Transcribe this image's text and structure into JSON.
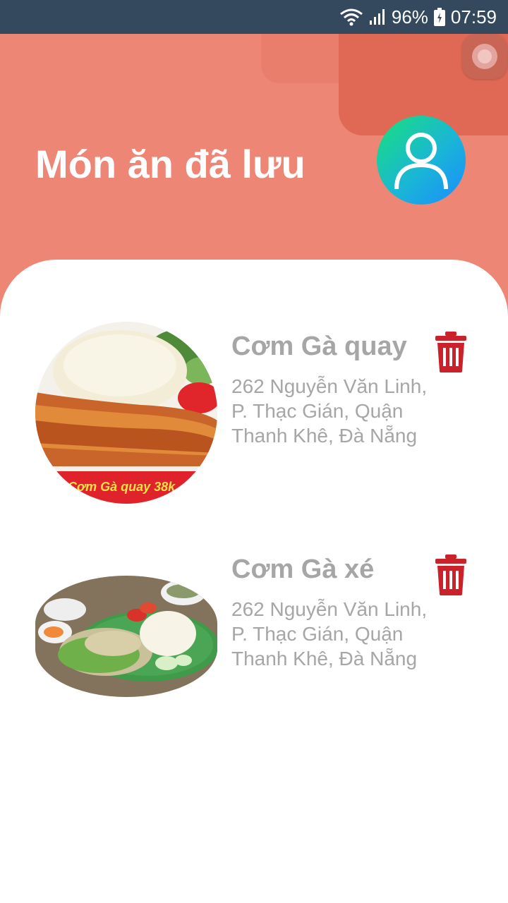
{
  "status_bar": {
    "battery": "96%",
    "time": "07:59"
  },
  "header": {
    "title": "Món ăn đã lưu"
  },
  "saved_items": [
    {
      "name": "Cơm Gà quay",
      "address": " 262 Nguyễn Văn Linh, P. Thạc Gián, Quận Thanh Khê, Đà Nẵng",
      "image_banner": "Cơm Gà quay 38k"
    },
    {
      "name": "Cơm Gà xé",
      "address": " 262 Nguyễn Văn Linh, P. Thạc Gián, Quận Thanh Khê, Đà Nẵng"
    }
  ],
  "colors": {
    "status_bar": "#34495e",
    "header_bg": "#ee8676",
    "delete_icon": "#c9222a",
    "text_muted": "#a6a6a6"
  },
  "icons": [
    "wifi-icon",
    "signal-icon",
    "battery-icon",
    "assistive-touch-button",
    "user-icon",
    "trash-icon"
  ]
}
